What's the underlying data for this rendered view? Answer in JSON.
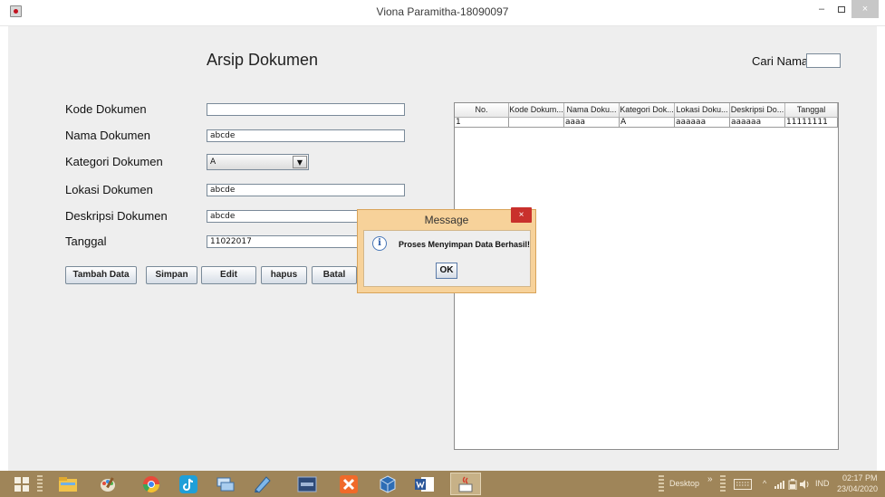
{
  "window": {
    "title": "Viona Paramitha-18090097",
    "minimize": "–",
    "close": "×"
  },
  "header": {
    "title": "Arsip Dokumen",
    "search_label": "Cari Nama",
    "search_value": ""
  },
  "form": {
    "kode_label": "Kode Dokumen",
    "kode_value": "",
    "nama_label": "Nama Dokumen",
    "nama_value": "abcde",
    "kategori_label": "Kategori Dokumen",
    "kategori_value": "A",
    "lokasi_label": "Lokasi Dokumen",
    "lokasi_value": "abcde",
    "deskripsi_label": "Deskripsi Dokumen",
    "deskripsi_value": "abcde",
    "tanggal_label": "Tanggal",
    "tanggal_value": "11022017"
  },
  "buttons": {
    "tambah": "Tambah Data",
    "simpan": "Simpan",
    "edit": "Edit",
    "hapus": "hapus",
    "batal": "Batal"
  },
  "table": {
    "headers": [
      "No.",
      "Kode Dokum...",
      "Nama Doku...",
      "Kategori Dok...",
      "Lokasi Doku...",
      "Deskripsi Do...",
      "Tanggal"
    ],
    "rows": [
      [
        "1",
        "",
        "aaaa",
        "A",
        "aaaaaa",
        "aaaaaa",
        "11111111"
      ]
    ]
  },
  "dialog": {
    "title": "Message",
    "message": "Proses Menyimpan Data Berhasil!",
    "ok": "OK",
    "close": "×",
    "icon_glyph": "i"
  },
  "taskbar": {
    "desktop_label": "Desktop",
    "chevron": "»",
    "language": "IND",
    "time": "02:17 PM",
    "date": "23/04/2020",
    "tray_caret": "^"
  },
  "colors": {
    "taskbar": "#9f8559",
    "dialog_frame": "#f7d29a",
    "close_red": "#c9302c"
  }
}
